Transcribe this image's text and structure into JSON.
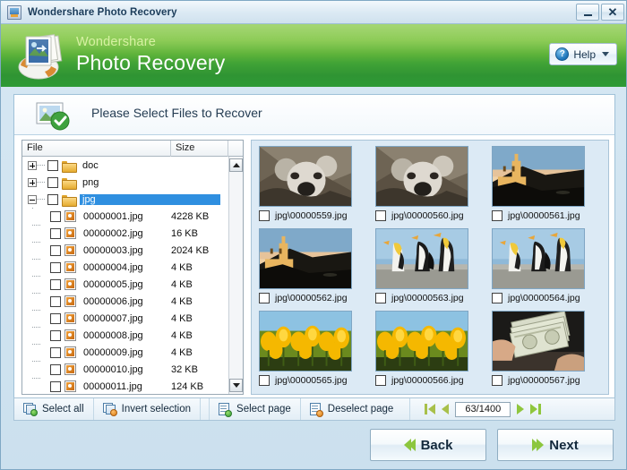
{
  "window": {
    "title": "Wondershare Photo Recovery",
    "icon": "app-icon",
    "minimize_label": "–",
    "close_label": "✕"
  },
  "banner": {
    "brand_sub": "Wondershare",
    "brand_main": "Photo Recovery",
    "help_label": "Help",
    "help_glyph": "?",
    "green_top": "#8ccb4e",
    "green_bottom": "#2e9a35"
  },
  "step": {
    "title": "Please Select Files to Recover",
    "icon": "photo-check-icon"
  },
  "tree": {
    "columns": [
      "File",
      "Size"
    ],
    "rows": [
      {
        "name": "doc",
        "size": "",
        "type": "folder",
        "expander": "plus",
        "level": 0,
        "selected": false
      },
      {
        "name": "png",
        "size": "",
        "type": "folder",
        "expander": "plus",
        "level": 0,
        "selected": false
      },
      {
        "name": "jpg",
        "size": "",
        "type": "folder",
        "expander": "minus",
        "level": 0,
        "selected": true
      },
      {
        "name": "00000001.jpg",
        "size": "4228 KB",
        "type": "file",
        "expander": "",
        "level": 1,
        "selected": false
      },
      {
        "name": "00000002.jpg",
        "size": "16 KB",
        "type": "file",
        "expander": "",
        "level": 1,
        "selected": false
      },
      {
        "name": "00000003.jpg",
        "size": "2024 KB",
        "type": "file",
        "expander": "",
        "level": 1,
        "selected": false
      },
      {
        "name": "00000004.jpg",
        "size": "4 KB",
        "type": "file",
        "expander": "",
        "level": 1,
        "selected": false
      },
      {
        "name": "00000005.jpg",
        "size": "4 KB",
        "type": "file",
        "expander": "",
        "level": 1,
        "selected": false
      },
      {
        "name": "00000006.jpg",
        "size": "4 KB",
        "type": "file",
        "expander": "",
        "level": 1,
        "selected": false
      },
      {
        "name": "00000007.jpg",
        "size": "4 KB",
        "type": "file",
        "expander": "",
        "level": 1,
        "selected": false
      },
      {
        "name": "00000008.jpg",
        "size": "4 KB",
        "type": "file",
        "expander": "",
        "level": 1,
        "selected": false
      },
      {
        "name": "00000009.jpg",
        "size": "4 KB",
        "type": "file",
        "expander": "",
        "level": 1,
        "selected": false
      },
      {
        "name": "00000010.jpg",
        "size": "32 KB",
        "type": "file",
        "expander": "",
        "level": 1,
        "selected": false
      },
      {
        "name": "00000011.jpg",
        "size": "124 KB",
        "type": "file",
        "expander": "",
        "level": 1,
        "selected": false
      }
    ]
  },
  "thumbnails": [
    {
      "label": "jpg\\00000559.jpg",
      "image": "koala",
      "checked": false
    },
    {
      "label": "jpg\\00000560.jpg",
      "image": "koala",
      "checked": false
    },
    {
      "label": "jpg\\00000561.jpg",
      "image": "castle",
      "checked": false
    },
    {
      "label": "jpg\\00000562.jpg",
      "image": "castle",
      "checked": false
    },
    {
      "label": "jpg\\00000563.jpg",
      "image": "penguins",
      "checked": false
    },
    {
      "label": "jpg\\00000564.jpg",
      "image": "penguins",
      "checked": false
    },
    {
      "label": "jpg\\00000565.jpg",
      "image": "tulips",
      "checked": false
    },
    {
      "label": "jpg\\00000566.jpg",
      "image": "tulips",
      "checked": false
    },
    {
      "label": "jpg\\00000567.jpg",
      "image": "money",
      "checked": false
    }
  ],
  "toolbar": {
    "select_all": "Select all",
    "invert_selection": "Invert selection",
    "select_page": "Select page",
    "deselect_page": "Deselect page",
    "page_value": "63/1400",
    "first_page": "first-page",
    "prev_page": "previous-page",
    "next_page": "next-page",
    "last_page": "last-page"
  },
  "footer": {
    "back": "Back",
    "next": "Next"
  }
}
